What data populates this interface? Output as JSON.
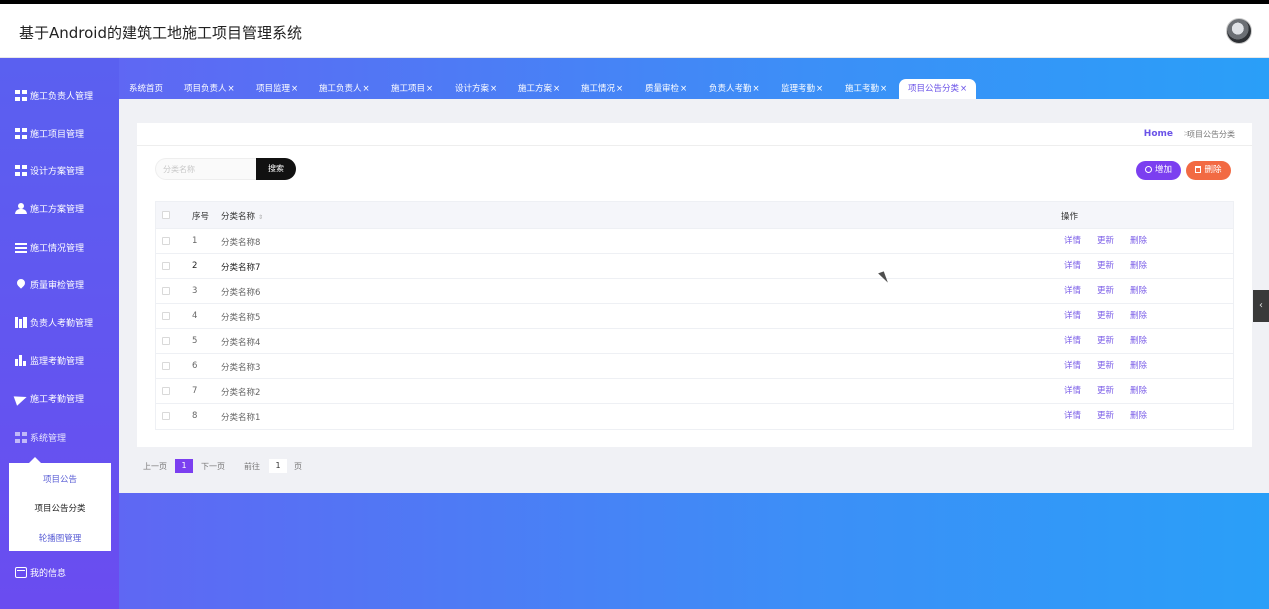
{
  "app": {
    "title": "基于Android的建筑工地施工项目管理系统"
  },
  "sidebar": {
    "items": [
      {
        "label": "施工负责人管理",
        "icon": "grid-icon"
      },
      {
        "label": "施工项目管理",
        "icon": "grid-icon"
      },
      {
        "label": "设计方案管理",
        "icon": "grid-icon"
      },
      {
        "label": "施工方案管理",
        "icon": "user-icon"
      },
      {
        "label": "施工情况管理",
        "icon": "list-icon"
      },
      {
        "label": "质量审检管理",
        "icon": "pin-icon"
      },
      {
        "label": "负责人考勤管理",
        "icon": "book-icon"
      },
      {
        "label": "监理考勤管理",
        "icon": "bar-chart-icon"
      },
      {
        "label": "施工考勤管理",
        "icon": "send-icon"
      },
      {
        "label": "系统管理",
        "icon": "grid-icon"
      }
    ],
    "submenu": [
      "项目公告",
      "项目公告分类",
      "轮播图管理"
    ],
    "submenu_active": "项目公告分类",
    "my_info": "我的信息"
  },
  "tabs": [
    {
      "label": "系统首页",
      "closable": false
    },
    {
      "label": "项目负责人",
      "closable": true
    },
    {
      "label": "项目监理",
      "closable": true
    },
    {
      "label": "施工负责人",
      "closable": true
    },
    {
      "label": "施工项目",
      "closable": true
    },
    {
      "label": "设计方案",
      "closable": true
    },
    {
      "label": "施工方案",
      "closable": true
    },
    {
      "label": "施工情况",
      "closable": true
    },
    {
      "label": "质量审检",
      "closable": true
    },
    {
      "label": "负责人考勤",
      "closable": true
    },
    {
      "label": "监理考勤",
      "closable": true
    },
    {
      "label": "施工考勤",
      "closable": true
    },
    {
      "label": "项目公告分类",
      "closable": true,
      "active": true
    }
  ],
  "tab_close_glyph": "×",
  "breadcrumb": {
    "home": "Home",
    "separator": ">",
    "current": "项目公告分类"
  },
  "search": {
    "placeholder": "分类名称",
    "button": "搜索"
  },
  "actions": {
    "add": "增加",
    "delete": "删除"
  },
  "table": {
    "headers": {
      "no": "序号",
      "name": "分类名称",
      "ops": "操作"
    },
    "op_labels": {
      "detail": "详情",
      "update": "更新",
      "delete": "删除"
    },
    "rows": [
      {
        "no": "1",
        "name": "分类名称8"
      },
      {
        "no": "2",
        "name": "分类名称7"
      },
      {
        "no": "3",
        "name": "分类名称6"
      },
      {
        "no": "4",
        "name": "分类名称5"
      },
      {
        "no": "5",
        "name": "分类名称4"
      },
      {
        "no": "6",
        "name": "分类名称3"
      },
      {
        "no": "7",
        "name": "分类名称2"
      },
      {
        "no": "8",
        "name": "分类名称1"
      }
    ]
  },
  "pager": {
    "prev": "上一页",
    "current": "1",
    "next": "下一页",
    "goto": "前往",
    "goto_value": "1",
    "page_unit": "页"
  },
  "colors": {
    "accent": "#7b3ff0",
    "danger": "#f26a43",
    "sidebar": "#5a60f0",
    "main_gradient_end": "#2a9ff8"
  }
}
